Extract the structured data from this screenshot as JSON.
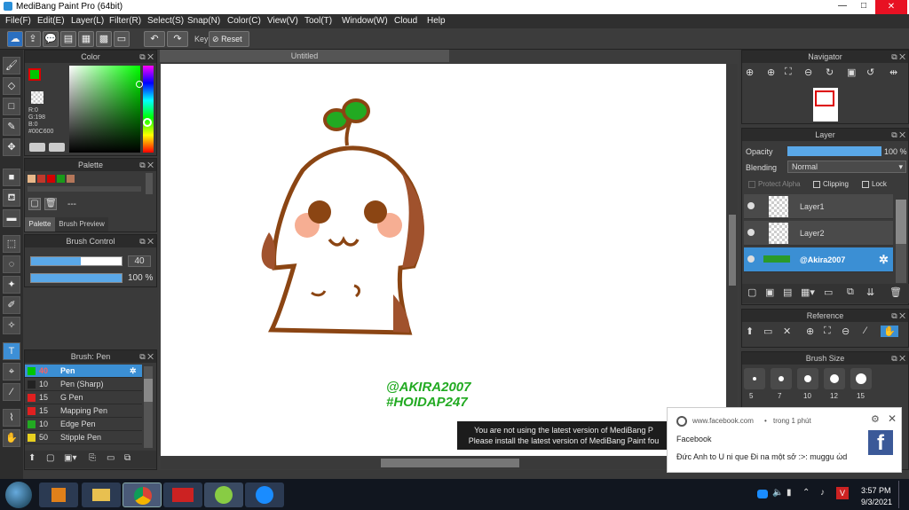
{
  "app": {
    "title": "MediBang Paint Pro (64bit)",
    "window_controls": [
      "—",
      "□",
      "✕"
    ]
  },
  "menu": [
    "File(F)",
    "Edit(E)",
    "Layer(L)",
    "Filter(R)",
    "Select(S)",
    "Snap(N)",
    "Color(C)",
    "View(V)",
    "Tool(T)",
    "Window(W)",
    "Cloud",
    "Help"
  ],
  "toolbar": {
    "key_label": "Key",
    "reset_label": "Reset"
  },
  "color_panel": {
    "title": "Color",
    "r": "R:0",
    "g": "G:198",
    "b": "B:0",
    "hex": "#00C600",
    "main_color": "#00c600"
  },
  "palette_panel": {
    "title": "Palette",
    "dash": "---",
    "tab_palette": "Palette",
    "tab_brush_preview": "Brush Preview",
    "swatches": [
      "#e8b88a",
      "#c0392b",
      "#d40000",
      "#1a9a1a",
      "#b5775a"
    ]
  },
  "brush_control": {
    "title": "Brush Control",
    "size": "40",
    "opacity": "100 %",
    "size_fraction": 0.55,
    "opacity_fraction": 1.0
  },
  "brush_list": {
    "title": "Brush: Pen",
    "items": [
      {
        "size": "40",
        "name": "Pen",
        "color": "#00c600"
      },
      {
        "size": "10",
        "name": "Pen (Sharp)",
        "color": "#222222"
      },
      {
        "size": "15",
        "name": "G Pen",
        "color": "#e02020"
      },
      {
        "size": "15",
        "name": "Mapping Pen",
        "color": "#e02020"
      },
      {
        "size": "10",
        "name": "Edge Pen",
        "color": "#22aa22"
      },
      {
        "size": "50",
        "name": "Stipple Pen",
        "color": "#e8d020"
      }
    ]
  },
  "canvas": {
    "tab_title": "Untitled",
    "watermark_line1": "@AKIRA2007",
    "watermark_line2": "#HOIDAP247",
    "update_line1": "You are not using the latest version of MediBang P",
    "update_line2": "Please install the latest version of MediBang Paint fou"
  },
  "navigator": {
    "title": "Navigator"
  },
  "layer_panel": {
    "title": "Layer",
    "opacity_label": "Opacity",
    "opacity_value": "100 %",
    "opacity_fraction": 1.0,
    "blending_label": "Blending",
    "blending_value": "Normal",
    "protect_alpha": "Protect Alpha",
    "clipping": "Clipping",
    "lock": "Lock",
    "layers": [
      "Layer1",
      "Layer2",
      "@Akira2007"
    ]
  },
  "reference": {
    "title": "Reference"
  },
  "brush_size": {
    "title": "Brush Size",
    "sizes": [
      "5",
      "7",
      "10",
      "12",
      "15"
    ]
  },
  "notification": {
    "source": "www.facebook.com",
    "dot": "•",
    "time": "trong 1 phút",
    "app": "Facebook",
    "message": "Đức Anh to U ni que Đi na một sở :>: muggu ὠd"
  },
  "taskbar": {
    "time": "3:57 PM",
    "date": "9/3/2021"
  }
}
